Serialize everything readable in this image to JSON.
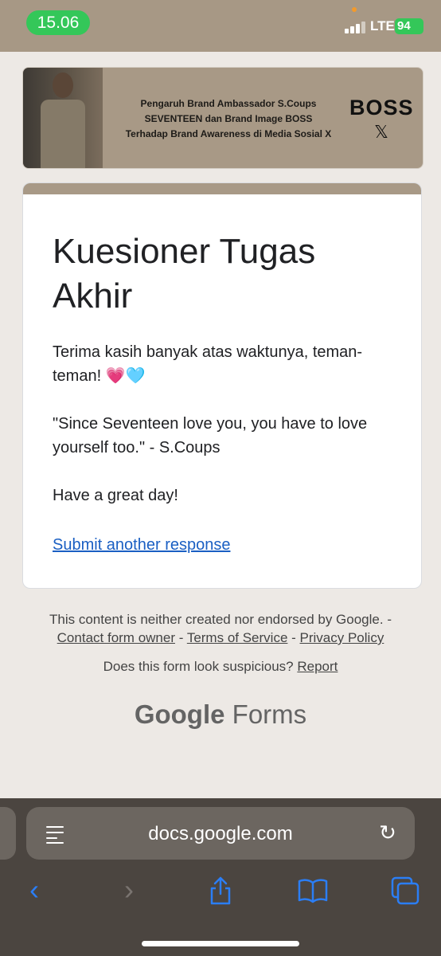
{
  "status_bar": {
    "time": "15.06",
    "network": "LTE",
    "battery": "94"
  },
  "banner": {
    "text_lines": [
      "Pengaruh Brand Ambassador S.Coups",
      "SEVENTEEN dan Brand Image BOSS",
      "Terhadap Brand Awareness di Media Sosial X"
    ],
    "brand": "BOSS",
    "x_logo": "𝕏"
  },
  "form": {
    "title": "Kuesioner Tugas Akhir",
    "desc1": "Terima kasih banyak atas waktunya, teman-teman! 💗🩵",
    "desc2": "\"Since Seventeen love you, you have to love yourself too.\" - S.Coups",
    "desc3": "Have a great day!",
    "submit_another": "Submit another response",
    "accent_color": "#a89986"
  },
  "footer": {
    "disclaimer": "This content is neither created nor endorsed by Google. -",
    "contact": "Contact form owner",
    "sep1": " - ",
    "terms": "Terms of Service",
    "sep2": " - ",
    "privacy": "Privacy Policy",
    "suspicious": "Does this form look suspicious?",
    "report": "Report",
    "logo_google": "Google",
    "logo_forms": "Forms"
  },
  "browser": {
    "url": "docs.google.com",
    "icons": [
      "reader-icon",
      "reload-icon",
      "back-icon",
      "forward-icon",
      "share-icon",
      "bookmarks-icon",
      "tabs-icon"
    ]
  }
}
